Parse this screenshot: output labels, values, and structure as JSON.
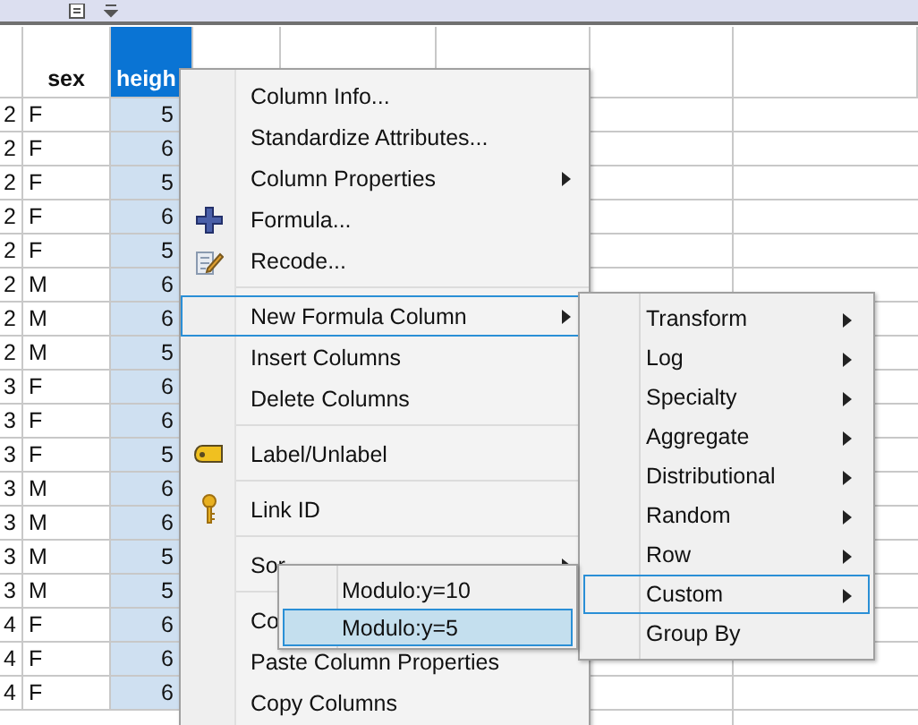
{
  "grid": {
    "columns": [
      {
        "selected": false
      },
      {
        "label": "sex",
        "selected": false
      },
      {
        "label": "heigh",
        "selected": true
      },
      {
        "selected": false
      },
      {
        "selected": false
      },
      {
        "selected": false
      },
      {
        "selected": false
      },
      {
        "selected": false
      }
    ],
    "rows": [
      [
        "2",
        "F",
        "5"
      ],
      [
        "2",
        "F",
        "6"
      ],
      [
        "2",
        "F",
        "5"
      ],
      [
        "2",
        "F",
        "6"
      ],
      [
        "2",
        "F",
        "5"
      ],
      [
        "2",
        "M",
        "6"
      ],
      [
        "2",
        "M",
        "6"
      ],
      [
        "2",
        "M",
        "5"
      ],
      [
        "3",
        "F",
        "6"
      ],
      [
        "3",
        "F",
        "6"
      ],
      [
        "3",
        "F",
        "5"
      ],
      [
        "3",
        "M",
        "6"
      ],
      [
        "3",
        "M",
        "6"
      ],
      [
        "3",
        "M",
        "5"
      ],
      [
        "3",
        "M",
        "5"
      ],
      [
        "4",
        "F",
        "6"
      ],
      [
        "4",
        "F",
        "6"
      ],
      [
        "4",
        "F",
        "6"
      ]
    ]
  },
  "context_menu": {
    "groups": [
      [
        {
          "label": "Column Info...",
          "kind": "plain",
          "submenu": false,
          "highlighted": false
        },
        {
          "label": "Standardize Attributes...",
          "kind": "plain",
          "submenu": false,
          "highlighted": false
        },
        {
          "label": "Column Properties",
          "kind": "plain",
          "submenu": true,
          "highlighted": false
        },
        {
          "label": "Formula...",
          "kind": "formula",
          "submenu": false,
          "highlighted": false
        },
        {
          "label": "Recode...",
          "kind": "recode",
          "submenu": false,
          "highlighted": false
        }
      ],
      [
        {
          "label": "New Formula Column",
          "kind": "plain",
          "submenu": true,
          "highlighted": true
        },
        {
          "label": "Insert Columns",
          "kind": "plain",
          "submenu": false,
          "highlighted": false
        },
        {
          "label": "Delete Columns",
          "kind": "plain",
          "submenu": false,
          "highlighted": false
        }
      ],
      [
        {
          "label": "Label/Unlabel",
          "kind": "label",
          "submenu": false,
          "highlighted": false
        }
      ],
      [
        {
          "label": "Link ID",
          "kind": "link",
          "submenu": false,
          "highlighted": false
        }
      ],
      [
        {
          "label": "Sor",
          "kind": "plain",
          "submenu": true,
          "highlighted": false
        }
      ],
      [
        {
          "label": "Co",
          "kind": "plain",
          "submenu": false,
          "highlighted": false
        },
        {
          "label": "Paste Column Properties",
          "kind": "plain",
          "submenu": false,
          "highlighted": false
        },
        {
          "label": "Copy Columns",
          "kind": "plain",
          "submenu": false,
          "highlighted": false
        }
      ]
    ]
  },
  "formula_submenu": {
    "items": [
      {
        "label": "Transform",
        "submenu": true,
        "highlighted": false
      },
      {
        "label": "Log",
        "submenu": true,
        "highlighted": false
      },
      {
        "label": "Specialty",
        "submenu": true,
        "highlighted": false
      },
      {
        "label": "Aggregate",
        "submenu": true,
        "highlighted": false
      },
      {
        "label": "Distributional",
        "submenu": true,
        "highlighted": false
      },
      {
        "label": "Random",
        "submenu": true,
        "highlighted": false
      },
      {
        "label": "Row",
        "submenu": true,
        "highlighted": false
      },
      {
        "label": "Custom",
        "submenu": true,
        "highlighted": true
      },
      {
        "label": "Group By",
        "submenu": false,
        "highlighted": false
      }
    ]
  },
  "custom_submenu": {
    "items": [
      {
        "label": "Modulo:y=10",
        "selected": false
      },
      {
        "label": "Modulo:y=5",
        "selected": true
      }
    ]
  }
}
